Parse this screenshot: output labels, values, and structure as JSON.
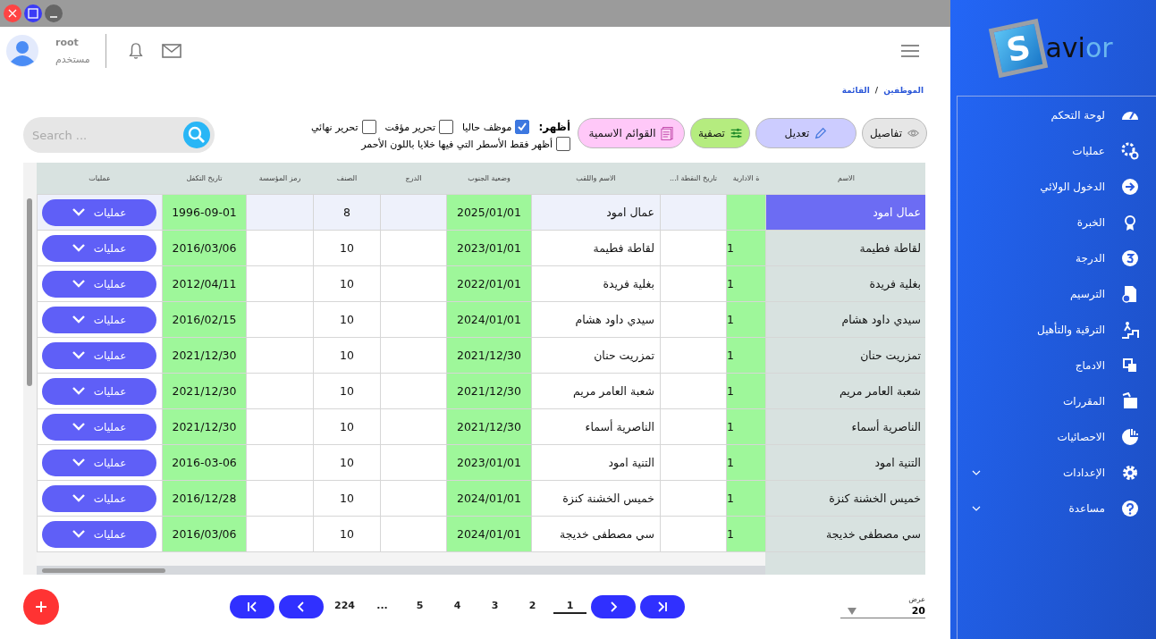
{
  "header": {
    "user_name": "root",
    "user_role": "مستخدم"
  },
  "breadcrumb": {
    "separator": "/",
    "items": [
      "الموظفين",
      "القائمة"
    ]
  },
  "toolbar": {
    "buttons": [
      {
        "label": "تفاصيل",
        "kind": "details"
      },
      {
        "label": "تعديل",
        "kind": "edit"
      },
      {
        "label": "تصفية",
        "kind": "filter"
      },
      {
        "label": "القوائم الاسمية",
        "kind": "lists"
      }
    ],
    "show_label": "أظهر:",
    "filters": [
      {
        "label": "موظف حاليا",
        "checked": true
      },
      {
        "label": "تحرير مؤقت",
        "checked": false
      },
      {
        "label": "تحرير نهائي",
        "checked": false
      }
    ],
    "red_only": {
      "label": "أظهر فقط الأسطر التي فيها خلايا باللون الأحمر",
      "checked": false
    },
    "search": {
      "placeholder": "Search ..."
    }
  },
  "table": {
    "columns": [
      "الاسم",
      "ة الادارية",
      "تاريخ النقطة ا...",
      "الاسم واللقب",
      "وضعية الجنوب",
      "الدرج",
      "الصنف",
      "رمز المؤسسة",
      "تاريخ التكفل",
      "عمليات"
    ],
    "rows": [
      {
        "selected": true,
        "cells": [
          "عمال امود",
          null,
          null,
          "عمال امود",
          "2025/01/01",
          null,
          "8",
          null,
          "1996-09-01"
        ],
        "action": "عمليات"
      },
      {
        "selected": false,
        "cells": [
          "لقاطة فطيمة",
          "1",
          null,
          "لقاطة فطيمة",
          "2023/01/01",
          null,
          "10",
          null,
          "2016/03/06"
        ],
        "action": "عمليات"
      },
      {
        "selected": false,
        "cells": [
          "بغلية فريدة",
          "1",
          null,
          "بغلية فريدة",
          "2022/01/01",
          null,
          "10",
          null,
          "2012/04/11"
        ],
        "action": "عمليات"
      },
      {
        "selected": false,
        "cells": [
          "سيدي داود هشام",
          "1",
          null,
          "سيدي داود هشام",
          "2024/01/01",
          null,
          "10",
          null,
          "2016/02/15"
        ],
        "action": "عمليات"
      },
      {
        "selected": false,
        "cells": [
          "تمزريت حنان",
          "1",
          null,
          "تمزريت حنان",
          "2021/12/30",
          null,
          "10",
          null,
          "2021/12/30"
        ],
        "action": "عمليات"
      },
      {
        "selected": false,
        "cells": [
          "شعبة العامر مريم",
          "1",
          null,
          "شعبة العامر مريم",
          "2021/12/30",
          null,
          "10",
          null,
          "2021/12/30"
        ],
        "action": "عمليات"
      },
      {
        "selected": false,
        "cells": [
          "الناصرية أسماء",
          "1",
          null,
          "الناصرية أسماء",
          "2021/12/30",
          null,
          "10",
          null,
          "2021/12/30"
        ],
        "action": "عمليات"
      },
      {
        "selected": false,
        "cells": [
          "التنية امود",
          "1",
          null,
          "التنية امود",
          "2023/01/01",
          null,
          "10",
          null,
          "2016-03-06"
        ],
        "action": "عمليات"
      },
      {
        "selected": false,
        "cells": [
          "خميس الخشنة كنزة",
          "1",
          null,
          "خميس الخشنة كنزة",
          "2024/01/01",
          null,
          "10",
          null,
          "2016/12/28"
        ],
        "action": "عمليات"
      },
      {
        "selected": false,
        "cells": [
          "سي مصطفى خديجة",
          "1",
          null,
          "سي مصطفى خديجة",
          "2024/01/01",
          null,
          "10",
          null,
          "2016/03/06"
        ],
        "action": "عمليات"
      }
    ]
  },
  "pagination": {
    "pages": [
      {
        "label": "1",
        "selected": true
      },
      {
        "label": "2",
        "selected": false
      },
      {
        "label": "3",
        "selected": false
      },
      {
        "label": "4",
        "selected": false
      },
      {
        "label": "5",
        "selected": false
      },
      {
        "label": "...",
        "selected": false
      },
      {
        "label": "224",
        "selected": false
      }
    ]
  },
  "page_size": {
    "label": "عرض",
    "value": "20"
  },
  "sidebar": {
    "logo": {
      "letter": "S",
      "dark": "avi",
      "light": "or"
    },
    "items": [
      {
        "label": "لوحة التحكم",
        "kind": "link"
      },
      {
        "label": "عمليات",
        "kind": "link"
      },
      {
        "label": "الدخول الولائي",
        "kind": "link"
      },
      {
        "label": "الخبرة",
        "kind": "link"
      },
      {
        "label": "الدرجة",
        "kind": "link"
      },
      {
        "label": "الترسيم",
        "kind": "link"
      },
      {
        "label": "الترقية والتأهيل",
        "kind": "link"
      },
      {
        "label": "الادماج",
        "kind": "link"
      },
      {
        "label": "المقررات",
        "kind": "link"
      },
      {
        "label": "الاحصائيات",
        "kind": "link"
      },
      {
        "label": "الإعدادات",
        "kind": "group"
      },
      {
        "label": "مساعدة",
        "kind": "group"
      }
    ]
  }
}
